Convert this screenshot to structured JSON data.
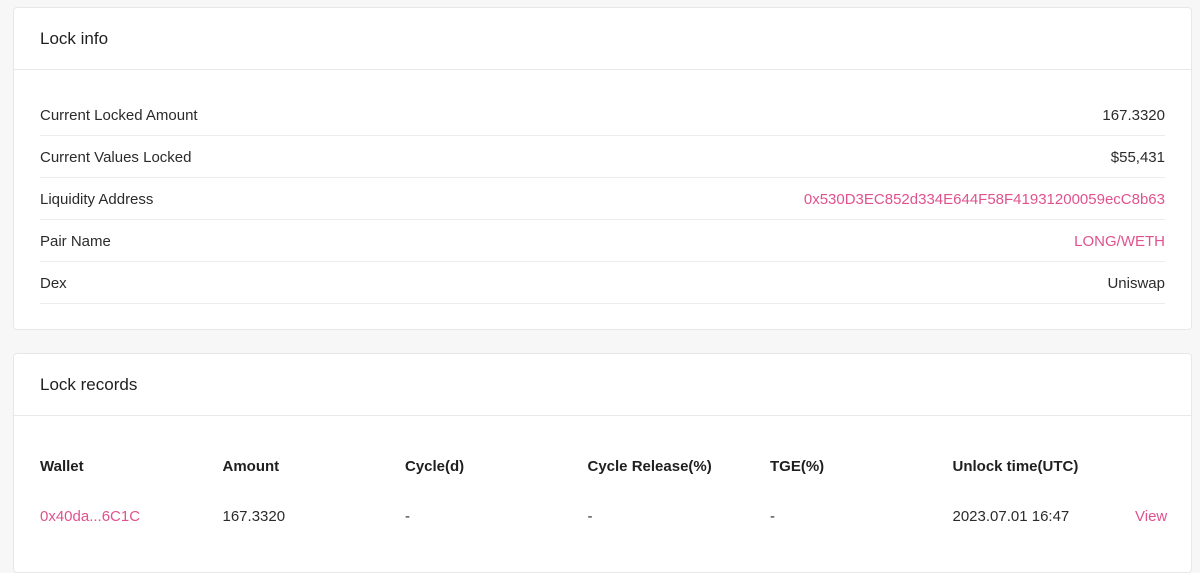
{
  "lock_info": {
    "title": "Lock info",
    "rows": [
      {
        "label": "Current Locked Amount",
        "value": "167.3320"
      },
      {
        "label": "Current Values Locked",
        "value": "$55,431"
      },
      {
        "label": "Liquidity Address",
        "value": "0x530D3EC852d334E644F58F41931200059ecC8b63"
      },
      {
        "label": "Pair Name",
        "value": "LONG/WETH"
      },
      {
        "label": "Dex",
        "value": "Uniswap"
      }
    ]
  },
  "lock_records": {
    "title": "Lock records",
    "columns": [
      "Wallet",
      "Amount",
      "Cycle(d)",
      "Cycle Release(%)",
      "TGE(%)",
      "Unlock time(UTC)"
    ],
    "rows": [
      {
        "wallet": "0x40da...6C1C",
        "amount": "167.3320",
        "cycle": "-",
        "cycle_release": "-",
        "tge": "-",
        "unlock_time": "2023.07.01 16:47",
        "action": "View"
      }
    ]
  },
  "colors": {
    "accent_link": "#e0528e",
    "card_bg": "#ffffff",
    "page_bg": "#f7f7f7",
    "border": "#e8e8e8"
  }
}
